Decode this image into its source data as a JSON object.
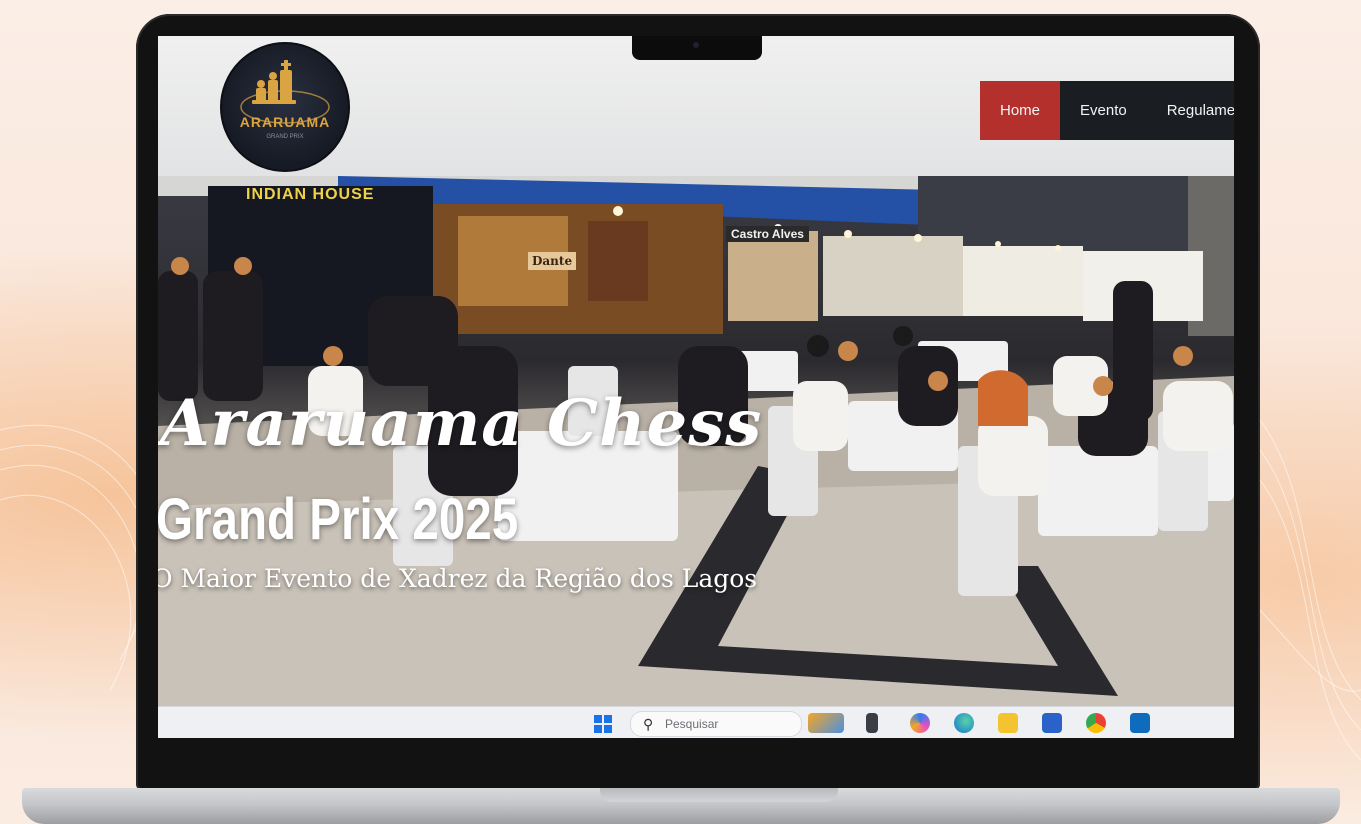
{
  "site": {
    "logo_text": "ARARUAMA",
    "nav": [
      {
        "label": "Home",
        "active": true
      },
      {
        "label": "Evento",
        "active": false
      },
      {
        "label": "Regulame",
        "active": false
      }
    ]
  },
  "hero": {
    "title": "Araruama Chess",
    "subtitle": "Grand Prix 2025",
    "tagline": "O Maior Evento de Xadrez da Região dos Lagos",
    "signs": {
      "store1": "INDIAN HOUSE",
      "store2": "Castro Alves",
      "store3": "Dante"
    }
  },
  "taskbar": {
    "search_placeholder": "Pesquisar",
    "icons": [
      "windows-start-icon",
      "widgets-icon",
      "task-view-icon",
      "copilot-icon",
      "edge-icon",
      "file-explorer-icon",
      "store-icon",
      "chrome-icon",
      "outlook-icon"
    ]
  },
  "colors": {
    "nav_active": "#b3302c",
    "nav_bg": "#1a1d22",
    "logo_gold": "#d9a441"
  }
}
